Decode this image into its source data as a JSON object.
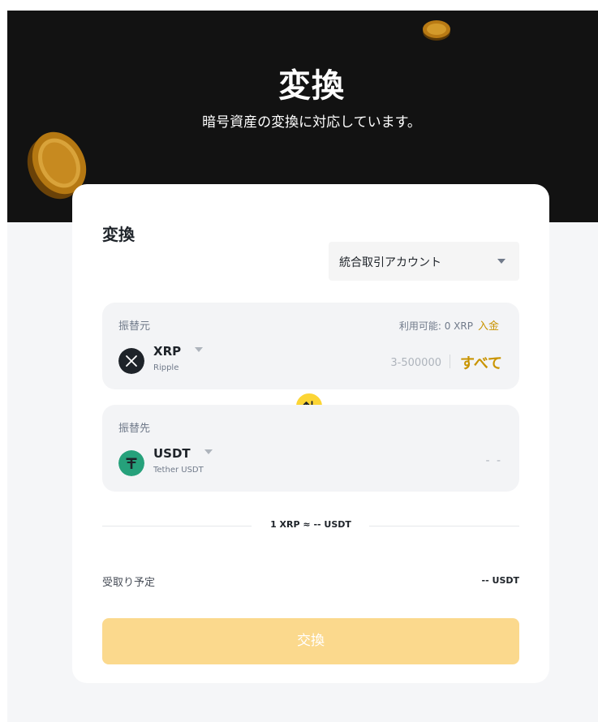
{
  "hero": {
    "title": "変換",
    "subtitle": "暗号資産の変換に対応しています。"
  },
  "card": {
    "title": "変換",
    "account_select": {
      "selected": "統合取引アカウント"
    },
    "from": {
      "label": "振替元",
      "available": "利用可能: 0 XRP",
      "deposit_link": "入金",
      "token": {
        "symbol": "XRP",
        "name": "Ripple",
        "icon": "xrp-icon"
      },
      "range": "3-500000",
      "max_button": "すべて"
    },
    "swap_icon": "swap-arrows-icon",
    "to": {
      "label": "振替先",
      "token": {
        "symbol": "USDT",
        "name": "Tether USDT",
        "icon": "tether-icon"
      },
      "amount": "- -"
    },
    "rate": "1 XRP ≈ -- USDT",
    "receive": {
      "label": "受取り予定",
      "value": "-- USDT"
    },
    "convert_button": "交換"
  },
  "colors": {
    "accent": "#c99400",
    "button_disabled": "#fbd98d",
    "swap": "#fcd535",
    "hero_bg": "#121212",
    "usdt": "#26a17b"
  }
}
